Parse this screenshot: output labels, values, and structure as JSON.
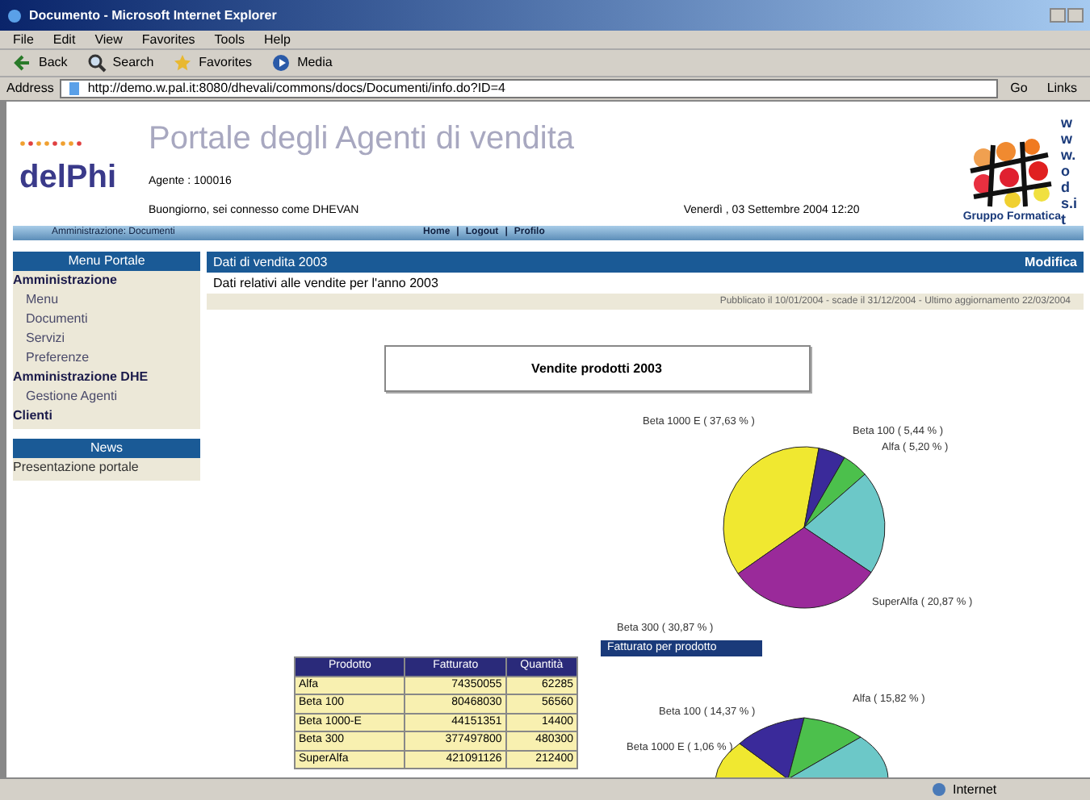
{
  "window": {
    "title": "Documento - Microsoft Internet Explorer"
  },
  "menu_bar": [
    "File",
    "Edit",
    "View",
    "Favorites",
    "Tools",
    "Help"
  ],
  "toolbar": [
    {
      "label": "Back",
      "kind": "back"
    },
    {
      "label": "Search",
      "kind": "search"
    },
    {
      "label": "Favorites",
      "kind": "favorites"
    },
    {
      "label": "Media",
      "kind": "media"
    }
  ],
  "address_bar": {
    "label": "Address",
    "value": "http://demo.w.pal.it:8080/dhevali/commons/docs/Documenti/info.do?ID=4",
    "go": "Go",
    "links": "Links"
  },
  "header": {
    "logo_text": "delPhi",
    "title": "Portale degli Agenti di vendita",
    "agent": "Agente : 100016",
    "greeting": "Buongiorno, sei connesso come DHEVAN",
    "date": "Venerdì , 03 Settembre 2004 12:20",
    "brand": "Gruppo Formatica",
    "site": "www.ods.it"
  },
  "nav_bar": {
    "breadcrumb": "Amministrazione: Documenti",
    "links": [
      "Home",
      "Logout",
      "Profilo"
    ],
    "separator": "|"
  },
  "sidebar": {
    "sections": [
      {
        "title": "Menu Portale",
        "items": [
          {
            "label": "Amministrazione",
            "kind": "group"
          },
          {
            "label": "Menu",
            "kind": "item"
          },
          {
            "label": "Documenti",
            "kind": "item"
          },
          {
            "label": "Servizi",
            "kind": "item"
          },
          {
            "label": "Preferenze",
            "kind": "item"
          },
          {
            "label": "Amministrazione DHE",
            "kind": "group"
          },
          {
            "label": "Gestione Agenti",
            "kind": "item"
          },
          {
            "label": "Clienti",
            "kind": "group"
          }
        ]
      },
      {
        "title": "News",
        "items": [
          {
            "label": "Presentazione portale",
            "kind": "link"
          }
        ]
      }
    ]
  },
  "document": {
    "title": "Dati di vendita 2003",
    "edit": "Modifica",
    "description": "Dati relativi alle vendite per l'anno 2003",
    "meta": "Pubblicato il 10/01/2004 - scade il 31/12/2004 - Ultimo aggiornamento 22/03/2004",
    "report_title": "Vendite prodotti 2003",
    "table": {
      "columns": [
        "Prodotto",
        "Fatturato",
        "Quantità"
      ],
      "rows": [
        [
          "Alfa",
          "74350055",
          "62285"
        ],
        [
          "Beta 100",
          "80468030",
          "56560"
        ],
        [
          "Beta 1000-E",
          "44151351",
          "14400"
        ],
        [
          "Beta 300",
          "377497800",
          "480300"
        ],
        [
          "SuperAlfa",
          "421091126",
          "212400"
        ]
      ]
    },
    "chart_button": "Fatturato per prodotto",
    "chart_data": {
      "type": "pie",
      "categories": [
        "Beta 1000 E",
        "Beta 100",
        "Alfa",
        "SuperAlfa",
        "Beta 300"
      ],
      "series": [
        {
          "values": [
            37.63,
            5.44,
            5.2,
            20.87,
            30.87
          ]
        }
      ],
      "colors": [
        "#f0e830",
        "#3a2a9a",
        "#4cc04c",
        "#6cc8c8",
        "#9a2a9a"
      ],
      "value_labels": [
        "( 37,63 % )",
        "( 5,44 % )",
        "( 5,20 % )",
        "( 20,87 % )",
        "( 30,87 % )"
      ]
    },
    "second_chart_labels": [
      "Beta 100  ( 14,37 % )",
      "Alfa  ( 15,82 % )",
      "Beta 1000 E  ( 1,06 % )"
    ]
  },
  "status_bar": {
    "zone": "Internet"
  }
}
